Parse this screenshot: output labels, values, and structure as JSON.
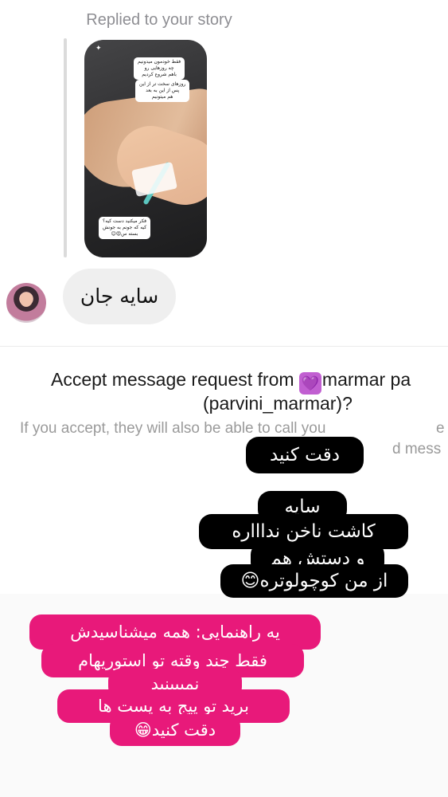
{
  "story_reply": {
    "label": "Replied to your story",
    "captions": [
      "فقط خودمون میدونیم\nچه روزهایی رو\nباهم شروع کردیم",
      "روزهای سخت تر از این\nپس از این به بعد\nهم میتونیم",
      "فکر میکنید دست کیه؟\nکیه که جونم به جونش\nبسته س😍😊"
    ]
  },
  "message": {
    "text": "سایه جان"
  },
  "request": {
    "prefix": "Accept message request from",
    "heart_icon": "💜",
    "name": "marmar pa",
    "username": "(parvini_marmar)?",
    "info": "If you accept, they will also be able to call you",
    "info_right1": "e",
    "info_right2": "d mess"
  },
  "overlay_black": {
    "line1": "دقت کنید",
    "line2": "سایه",
    "line3": "کاشت ناخن نداااره",
    "line4": "و دستش هم",
    "line5": "از من کوچولوتره😊"
  },
  "overlay_pink": {
    "line1": "یه راهنمایی: همه میشناسیدش",
    "line2": "فقط چند وقته تو استوریهام",
    "line3": "نمیبینید",
    "line4": "برید تو پیج به پست ها",
    "line5": "دقت کنید😁"
  }
}
